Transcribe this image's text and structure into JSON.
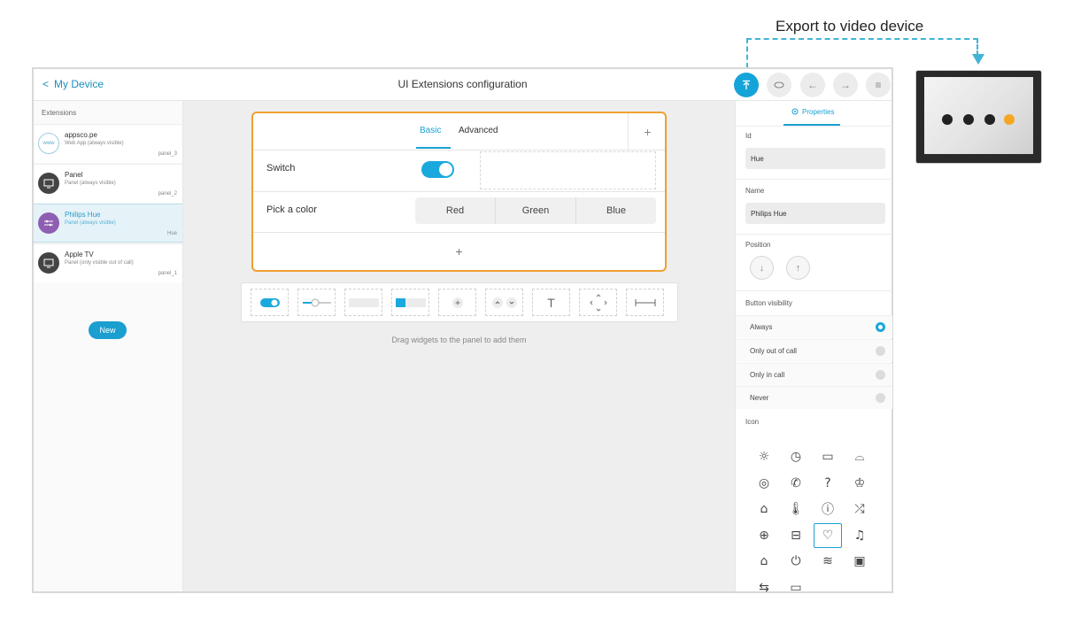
{
  "annotation": {
    "export_label": "Export to video device"
  },
  "topbar": {
    "back_label": "My Device",
    "title": "UI Extensions configuration",
    "buttons": [
      "export-icon",
      "preview-icon",
      "undo-icon",
      "redo-icon",
      "menu-icon"
    ]
  },
  "sidebar": {
    "header": "Extensions",
    "items": [
      {
        "name": "appsco.pe",
        "sub": "Web App (always visible)",
        "tag": "panel_3",
        "icon": "web-icon",
        "icon_text": "www"
      },
      {
        "name": "Panel",
        "sub": "Panel (always visible)",
        "tag": "panel_2",
        "icon": "monitor-icon"
      },
      {
        "name": "Philips Hue",
        "sub": "Panel (always visible)",
        "tag": "Hue",
        "icon": "sliders-icon",
        "selected": true
      },
      {
        "name": "Apple TV",
        "sub": "Panel (only visible out of call)",
        "tag": "panel_1",
        "icon": "monitor-icon"
      }
    ],
    "new_label": "New"
  },
  "panel": {
    "tabs": {
      "basic": "Basic",
      "advanced": "Advanced",
      "add": "+"
    },
    "rows": [
      {
        "label": "Switch",
        "widget": "toggle",
        "value": "on"
      },
      {
        "label": "Pick a color",
        "options": [
          "Red",
          "Green",
          "Blue"
        ]
      }
    ],
    "add_row": "+"
  },
  "widget_bar": {
    "widgets": [
      "toggle-widget",
      "slider-widget",
      "button-widget",
      "group-button-widget",
      "spinner-widget",
      "updown-widget",
      "text-widget",
      "directional-pad-widget",
      "spacer-widget"
    ],
    "text_glyph": "T",
    "hint": "Drag widgets to the panel to add them"
  },
  "properties": {
    "tab_label": "Properties",
    "id_label": "Id",
    "id_value": "Hue",
    "name_label": "Name",
    "name_value": "Philips Hue",
    "position_label": "Position",
    "visibility_label": "Button visibility",
    "visibility_options": [
      {
        "label": "Always",
        "selected": true
      },
      {
        "label": "Only out of call",
        "selected": false
      },
      {
        "label": "Only in call",
        "selected": false
      },
      {
        "label": "Never",
        "selected": false
      }
    ],
    "icon_label": "Icon",
    "icons": [
      {
        "name": "brightness-icon",
        "glyph": "☼"
      },
      {
        "name": "clock-icon",
        "glyph": "◷"
      },
      {
        "name": "camera-icon",
        "glyph": "▭"
      },
      {
        "name": "lamp-icon",
        "glyph": "⌓"
      },
      {
        "name": "disc-icon",
        "glyph": "◎"
      },
      {
        "name": "phone-icon",
        "glyph": "✆"
      },
      {
        "name": "help-icon",
        "glyph": "?"
      },
      {
        "name": "concierge-icon",
        "glyph": "♔"
      },
      {
        "name": "home-icon",
        "glyph": "⌂"
      },
      {
        "name": "thermometer-icon",
        "glyph": "🌡"
      },
      {
        "name": "info-icon",
        "glyph": "ⓘ"
      },
      {
        "name": "shuffle-icon",
        "glyph": "⤮"
      },
      {
        "name": "globe-icon",
        "glyph": "⊕"
      },
      {
        "name": "laptop-icon",
        "glyph": "⊟"
      },
      {
        "name": "lightbulb-icon",
        "glyph": "♡",
        "selected": true
      },
      {
        "name": "music-icon",
        "glyph": "♫"
      },
      {
        "name": "microphone-icon",
        "glyph": "⌂"
      },
      {
        "name": "power-icon",
        "glyph": "⏻"
      },
      {
        "name": "wifi-icon",
        "glyph": "≋"
      },
      {
        "name": "tv-box-icon",
        "glyph": "▣"
      },
      {
        "name": "sliders-icon",
        "glyph": "⇆"
      },
      {
        "name": "monitor-icon",
        "glyph": "▭"
      }
    ]
  },
  "colors": {
    "accent": "#1aa1d3",
    "panel_border": "#f0a030",
    "selected_item": "#8e5eb3"
  }
}
